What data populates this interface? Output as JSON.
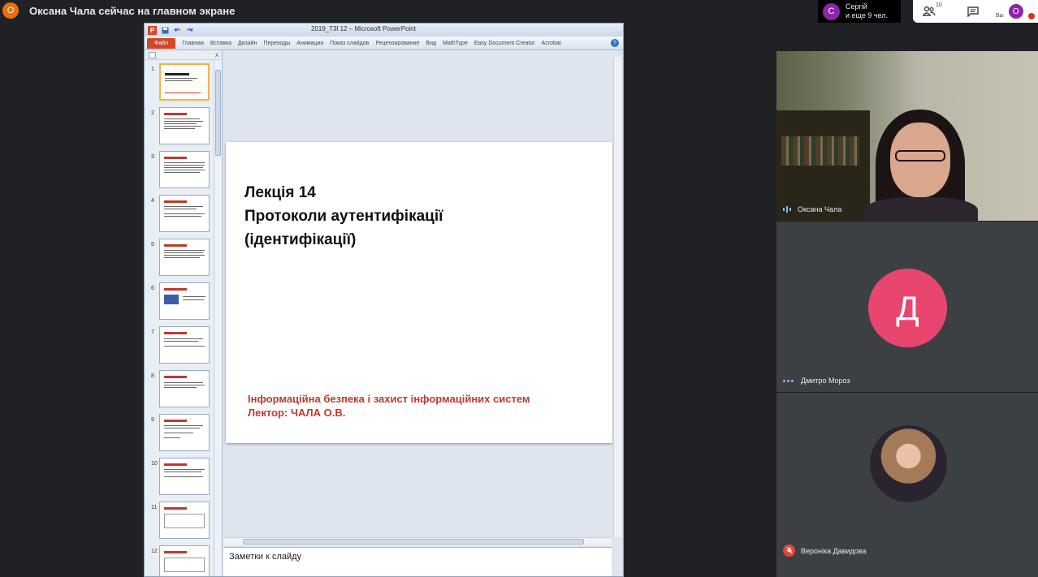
{
  "meet": {
    "presenter_avatar": "О",
    "presenter_text": "Оксана Чала сейчас на главном экране",
    "others_avatar": "С",
    "others_line1": "Сергій",
    "others_line2": "и еще 9 чел.",
    "people_count": "10",
    "you_label": "Вы",
    "you_avatar": "О",
    "icons": [
      "people-icon",
      "chat-icon",
      "mic-off-icon",
      "audio-wave-icon",
      "speaking-dots-icon"
    ],
    "accent_colors": {
      "presenter": "#e8710a",
      "purple": "#8e24aa",
      "pink": "#e8466e",
      "muted": "#ea4335"
    }
  },
  "ppt": {
    "window_title": "2019_T3l 12 – Microsoft PowerPoint",
    "app_logo": "P",
    "file_tab": "Файл",
    "tabs": [
      "Главная",
      "Вставка",
      "Дизайн",
      "Переходы",
      "Анимация",
      "Показ слайдов",
      "Рецензирование",
      "Вид",
      "MathType",
      "Easy Document Creator",
      "Acrobat"
    ],
    "help": "?",
    "pane_close": "x",
    "thumbnails": [
      "1",
      "2",
      "3",
      "4",
      "5",
      "6",
      "7",
      "8",
      "9",
      "10",
      "11",
      "12"
    ],
    "slide": {
      "title_line1": "Лекція 14",
      "title_line2": "Протоколи аутентифікації",
      "title_line3": "(ідентифікації)",
      "subtitle_line1": "Інформаційна безпека і захист інформаційних систем",
      "subtitle_line2": "Лектор: ЧАЛА О.В."
    },
    "notes_placeholder": "Заметки к слайду"
  },
  "participants": [
    {
      "name": "Оксана Чала"
    },
    {
      "name": "Дмитро Мороз",
      "initial": "Д"
    },
    {
      "name": "Вероніка Давидова"
    }
  ]
}
